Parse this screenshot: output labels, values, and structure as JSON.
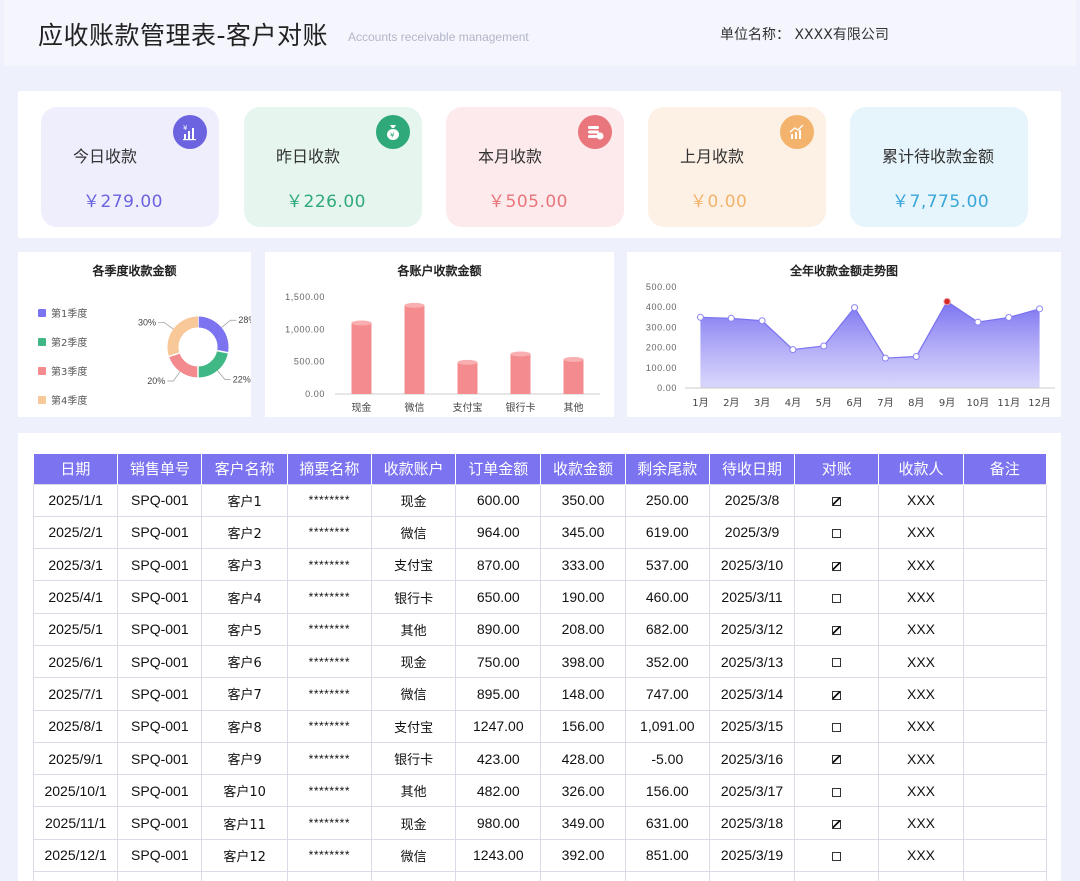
{
  "header": {
    "title": "应收账款管理表-客户对账",
    "subtitle": "Accounts receivable management",
    "company": "单位名称： XXXX有限公司"
  },
  "kpis": [
    {
      "label": "今日收款",
      "value": "￥279.00",
      "color": "#6b63e0",
      "bg": "#efeefd",
      "icon": "bar-chart-icon"
    },
    {
      "label": "昨日收款",
      "value": "￥226.00",
      "color": "#2fa97a",
      "bg": "#e6f6ef",
      "icon": "money-bag-icon"
    },
    {
      "label": "本月收款",
      "value": "￥505.00",
      "color": "#e8767c",
      "bg": "#fdeaec",
      "icon": "coins-icon"
    },
    {
      "label": "上月收款",
      "value": "￥0.00",
      "color": "#f3b36d",
      "bg": "#fdf0e5",
      "icon": "trend-chart-icon"
    },
    {
      "label": "累计待收款金额",
      "value": "￥7,775.00",
      "color": "#39a6d8",
      "bg": "#e6f4fc",
      "icon": ""
    }
  ],
  "chart_data": [
    {
      "type": "pie",
      "title": "各季度收款金额",
      "categories": [
        "第1季度",
        "第2季度",
        "第3季度",
        "第4季度"
      ],
      "values": [
        28,
        22,
        20,
        30
      ],
      "labels": [
        "28%",
        "22%",
        "20%",
        "30%"
      ],
      "colors": [
        "#7b73f0",
        "#3fb886",
        "#f28a8e",
        "#f9c898"
      ],
      "legend": "left"
    },
    {
      "type": "bar",
      "title": "各账户收款金额",
      "categories": [
        "现金",
        "微信",
        "支付宝",
        "银行卡",
        "其他"
      ],
      "values": [
        1097,
        1370,
        489,
        618,
        534
      ],
      "yticks": [
        "0.00",
        "500.00",
        "1,000.00",
        "1,500.00"
      ],
      "ylim": [
        0,
        1500
      ],
      "color": "#f48b8e"
    },
    {
      "type": "area",
      "title": "全年收款金额走势图",
      "categories": [
        "1月",
        "2月",
        "3月",
        "4月",
        "5月",
        "6月",
        "7月",
        "8月",
        "9月",
        "10月",
        "11月",
        "12月"
      ],
      "values": [
        350,
        345,
        333,
        190,
        208,
        398,
        148,
        156,
        428,
        326,
        349,
        392
      ],
      "yticks": [
        "0.00",
        "100.00",
        "200.00",
        "300.00",
        "400.00",
        "500.00"
      ],
      "ylim": [
        0,
        500
      ],
      "color": "#8b84f3",
      "highlight_index": 8
    }
  ],
  "table": {
    "columns": [
      "日期",
      "销售单号",
      "客户名称",
      "摘要名称",
      "收款账户",
      "订单金额",
      "收款金额",
      "剩余尾款",
      "待收日期",
      "对账",
      "收款人",
      "备注"
    ],
    "rows": [
      [
        "2025/1/1",
        "SPQ-001",
        "客户1",
        "********",
        "现金",
        "600.00",
        "350.00",
        "250.00",
        "2025/3/8",
        true,
        "XXX",
        ""
      ],
      [
        "2025/2/1",
        "SPQ-001",
        "客户2",
        "********",
        "微信",
        "964.00",
        "345.00",
        "619.00",
        "2025/3/9",
        false,
        "XXX",
        ""
      ],
      [
        "2025/3/1",
        "SPQ-001",
        "客户3",
        "********",
        "支付宝",
        "870.00",
        "333.00",
        "537.00",
        "2025/3/10",
        true,
        "XXX",
        ""
      ],
      [
        "2025/4/1",
        "SPQ-001",
        "客户4",
        "********",
        "银行卡",
        "650.00",
        "190.00",
        "460.00",
        "2025/3/11",
        false,
        "XXX",
        ""
      ],
      [
        "2025/5/1",
        "SPQ-001",
        "客户5",
        "********",
        "其他",
        "890.00",
        "208.00",
        "682.00",
        "2025/3/12",
        true,
        "XXX",
        ""
      ],
      [
        "2025/6/1",
        "SPQ-001",
        "客户6",
        "********",
        "现金",
        "750.00",
        "398.00",
        "352.00",
        "2025/3/13",
        false,
        "XXX",
        ""
      ],
      [
        "2025/7/1",
        "SPQ-001",
        "客户7",
        "********",
        "微信",
        "895.00",
        "148.00",
        "747.00",
        "2025/3/14",
        true,
        "XXX",
        ""
      ],
      [
        "2025/8/1",
        "SPQ-001",
        "客户8",
        "********",
        "支付宝",
        "1247.00",
        "156.00",
        "1,091.00",
        "2025/3/15",
        false,
        "XXX",
        ""
      ],
      [
        "2025/9/1",
        "SPQ-001",
        "客户9",
        "********",
        "银行卡",
        "423.00",
        "428.00",
        "-5.00",
        "2025/3/16",
        true,
        "XXX",
        ""
      ],
      [
        "2025/10/1",
        "SPQ-001",
        "客户10",
        "********",
        "其他",
        "482.00",
        "326.00",
        "156.00",
        "2025/3/17",
        false,
        "XXX",
        ""
      ],
      [
        "2025/11/1",
        "SPQ-001",
        "客户11",
        "********",
        "现金",
        "980.00",
        "349.00",
        "631.00",
        "2025/3/18",
        true,
        "XXX",
        ""
      ],
      [
        "2025/12/1",
        "SPQ-001",
        "客户12",
        "********",
        "微信",
        "1243.00",
        "392.00",
        "851.00",
        "2025/3/19",
        false,
        "XXX",
        ""
      ],
      [
        "",
        "",
        "",
        "",
        "",
        "",
        "",
        "",
        "",
        null,
        "",
        ""
      ]
    ]
  }
}
